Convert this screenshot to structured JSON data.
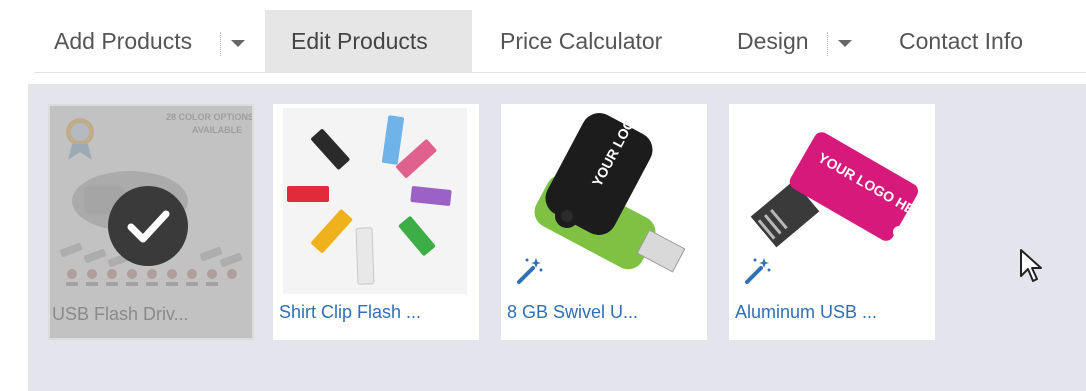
{
  "nav": {
    "add_products": "Add Products",
    "edit_products": "Edit Products",
    "price_calculator": "Price Calculator",
    "design": "Design",
    "contact_info": "Contact Info"
  },
  "products": [
    {
      "label": "USB Flash Driv...",
      "selected": true,
      "badge": "28 COLOR OPTIONS AVAILABLE",
      "icon": "check-icon"
    },
    {
      "label": "Shirt Clip Flash ...",
      "selected": false
    },
    {
      "label": "8 GB Swivel U...",
      "selected": false,
      "logo_text": "YOUR LOGO HERE",
      "icon": "magic-wand-icon"
    },
    {
      "label": "Aluminum USB ...",
      "selected": false,
      "logo_text": "YOUR LOGO HERE",
      "icon": "magic-wand-icon"
    }
  ],
  "colors": {
    "link": "#2f6fb6",
    "active_tab": "#e6e6e6",
    "panel": "#e4e4ec"
  }
}
